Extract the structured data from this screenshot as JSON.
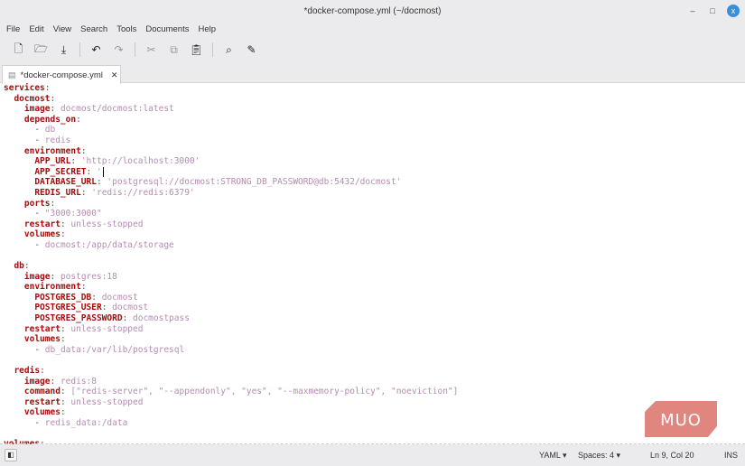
{
  "window": {
    "title": "*docker-compose.yml (~/docmost)",
    "minimize": "–",
    "maximize": "□",
    "close": "x"
  },
  "menu": [
    "File",
    "Edit",
    "View",
    "Search",
    "Tools",
    "Documents",
    "Help"
  ],
  "toolbar": {
    "icons": [
      "new-file-icon",
      "open-file-icon",
      "save-icon",
      "undo-icon",
      "redo-icon",
      "cut-icon",
      "copy-icon",
      "paste-icon",
      "search-icon",
      "replace-icon"
    ]
  },
  "tab": {
    "label": "*docker-compose.yml",
    "close": "✕"
  },
  "editor": {
    "lines": [
      {
        "i": 0,
        "k": "services"
      },
      {
        "i": 1,
        "k": "docmost"
      },
      {
        "i": 2,
        "k": "image",
        "v": "docmost/docmost:latest"
      },
      {
        "i": 2,
        "k": "depends_on"
      },
      {
        "i": 3,
        "d": true,
        "v": "db"
      },
      {
        "i": 3,
        "d": true,
        "v": "redis"
      },
      {
        "i": 2,
        "k": "environment"
      },
      {
        "i": 3,
        "k": "APP_URL",
        "v": "'http://localhost:3000'"
      },
      {
        "i": 3,
        "k": "APP_SECRET",
        "v": "'",
        "cursor": true
      },
      {
        "i": 3,
        "k": "DATABASE_URL",
        "v": "'postgresql://docmost:STRONG_DB_PASSWORD@db:5432/docmost'"
      },
      {
        "i": 3,
        "k": "REDIS_URL",
        "v": "'redis://redis:6379'"
      },
      {
        "i": 2,
        "k": "ports"
      },
      {
        "i": 3,
        "d": true,
        "v": "\"3000:3000\""
      },
      {
        "i": 2,
        "k": "restart",
        "v": "unless-stopped"
      },
      {
        "i": 2,
        "k": "volumes"
      },
      {
        "i": 3,
        "d": true,
        "v": "docmost:/app/data/storage"
      },
      {
        "i": 0
      },
      {
        "i": 1,
        "k": "db"
      },
      {
        "i": 2,
        "k": "image",
        "v": "postgres:18"
      },
      {
        "i": 2,
        "k": "environment"
      },
      {
        "i": 3,
        "k": "POSTGRES_DB",
        "v": "docmost"
      },
      {
        "i": 3,
        "k": "POSTGRES_USER",
        "v": "docmost"
      },
      {
        "i": 3,
        "k": "POSTGRES_PASSWORD",
        "v": "docmostpass"
      },
      {
        "i": 2,
        "k": "restart",
        "v": "unless-stopped"
      },
      {
        "i": 2,
        "k": "volumes"
      },
      {
        "i": 3,
        "d": true,
        "v": "db_data:/var/lib/postgresql"
      },
      {
        "i": 0
      },
      {
        "i": 1,
        "k": "redis"
      },
      {
        "i": 2,
        "k": "image",
        "v": "redis:8"
      },
      {
        "i": 2,
        "k": "command",
        "v": "[\"redis-server\", \"--appendonly\", \"yes\", \"--maxmemory-policy\", \"noeviction\"]"
      },
      {
        "i": 2,
        "k": "restart",
        "v": "unless-stopped"
      },
      {
        "i": 2,
        "k": "volumes"
      },
      {
        "i": 3,
        "d": true,
        "v": "redis_data:/data"
      },
      {
        "i": 0
      },
      {
        "i": 0,
        "k": "volumes"
      }
    ]
  },
  "status": {
    "language": "YAML",
    "indent": "Spaces: 4",
    "position": "Ln 9, Col 20",
    "mode": "INS"
  },
  "watermark": "MUO"
}
